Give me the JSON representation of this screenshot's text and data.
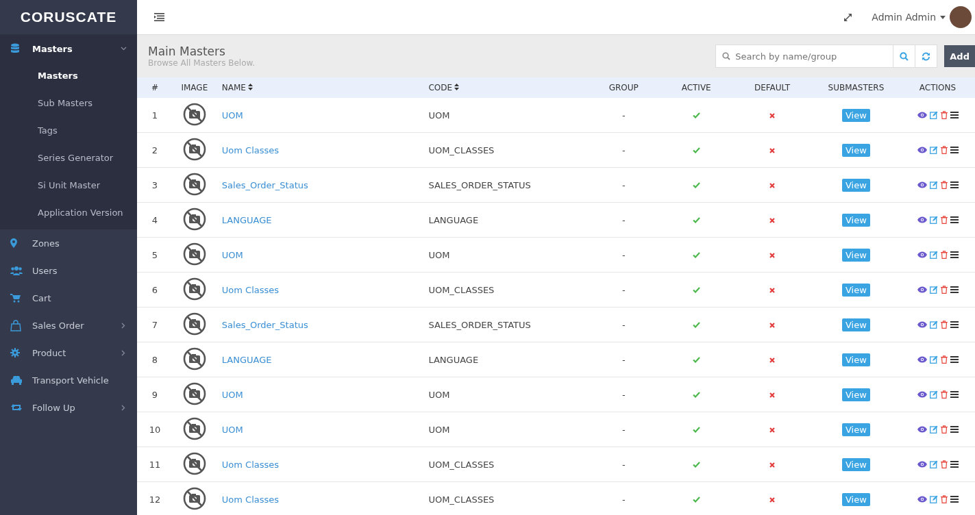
{
  "brand": "CORUSCATE",
  "sidebar": {
    "items": [
      {
        "label": "Masters",
        "kind": "group",
        "expanded": true,
        "children": [
          {
            "label": "Masters",
            "selected": true
          },
          {
            "label": "Sub Masters",
            "selected": false
          },
          {
            "label": "Tags",
            "selected": false
          },
          {
            "label": "Series Generator",
            "selected": false
          },
          {
            "label": "Si Unit Master",
            "selected": false
          },
          {
            "label": "Application Version",
            "selected": false
          }
        ]
      },
      {
        "label": "Zones",
        "kind": "link"
      },
      {
        "label": "Users",
        "kind": "link"
      },
      {
        "label": "Cart",
        "kind": "link"
      },
      {
        "label": "Sales Order",
        "kind": "group",
        "expanded": false
      },
      {
        "label": "Product",
        "kind": "group",
        "expanded": false
      },
      {
        "label": "Transport Vehicle",
        "kind": "link"
      },
      {
        "label": "Follow Up",
        "kind": "group",
        "expanded": false
      }
    ]
  },
  "topbar": {
    "user": "Admin Admin"
  },
  "page": {
    "title": "Main Masters",
    "subtitle": "Browse All Masters Below.",
    "search": {
      "placeholder": "Search by name/group"
    },
    "add_button": "Add"
  },
  "table": {
    "columns": [
      {
        "label": "#",
        "sortable": false
      },
      {
        "label": "IMAGE",
        "sortable": false
      },
      {
        "label": "NAME",
        "sortable": true
      },
      {
        "label": "CODE",
        "sortable": true
      },
      {
        "label": "GROUP",
        "sortable": false
      },
      {
        "label": "ACTIVE",
        "sortable": false
      },
      {
        "label": "DEFAULT",
        "sortable": false
      },
      {
        "label": "SUBMASTERS",
        "sortable": false
      },
      {
        "label": "ACTIONS",
        "sortable": false
      }
    ],
    "rows": [
      {
        "n": "1",
        "name": "UOM",
        "code": "UOM",
        "group": "-",
        "active": true,
        "default": false,
        "submasters": "View"
      },
      {
        "n": "2",
        "name": "Uom Classes",
        "code": "UOM_CLASSES",
        "group": "-",
        "active": true,
        "default": false,
        "submasters": "View"
      },
      {
        "n": "3",
        "name": "Sales_Order_Status",
        "code": "SALES_ORDER_STATUS",
        "group": "-",
        "active": true,
        "default": false,
        "submasters": "View"
      },
      {
        "n": "4",
        "name": "LANGUAGE",
        "code": "LANGUAGE",
        "group": "-",
        "active": true,
        "default": false,
        "submasters": "View"
      },
      {
        "n": "5",
        "name": "UOM",
        "code": "UOM",
        "group": "-",
        "active": true,
        "default": false,
        "submasters": "View"
      },
      {
        "n": "6",
        "name": "Uom Classes",
        "code": "UOM_CLASSES",
        "group": "-",
        "active": true,
        "default": false,
        "submasters": "View"
      },
      {
        "n": "7",
        "name": "Sales_Order_Status",
        "code": "SALES_ORDER_STATUS",
        "group": "-",
        "active": true,
        "default": false,
        "submasters": "View"
      },
      {
        "n": "8",
        "name": "LANGUAGE",
        "code": "LANGUAGE",
        "group": "-",
        "active": true,
        "default": false,
        "submasters": "View"
      },
      {
        "n": "9",
        "name": "UOM",
        "code": "UOM",
        "group": "-",
        "active": true,
        "default": false,
        "submasters": "View"
      },
      {
        "n": "10",
        "name": "UOM",
        "code": "UOM",
        "group": "-",
        "active": true,
        "default": false,
        "submasters": "View"
      },
      {
        "n": "11",
        "name": "Uom Classes",
        "code": "UOM_CLASSES",
        "group": "-",
        "active": true,
        "default": false,
        "submasters": "View"
      },
      {
        "n": "12",
        "name": "Uom Classes",
        "code": "UOM_CLASSES",
        "group": "-",
        "active": true,
        "default": false,
        "submasters": "View"
      }
    ]
  }
}
